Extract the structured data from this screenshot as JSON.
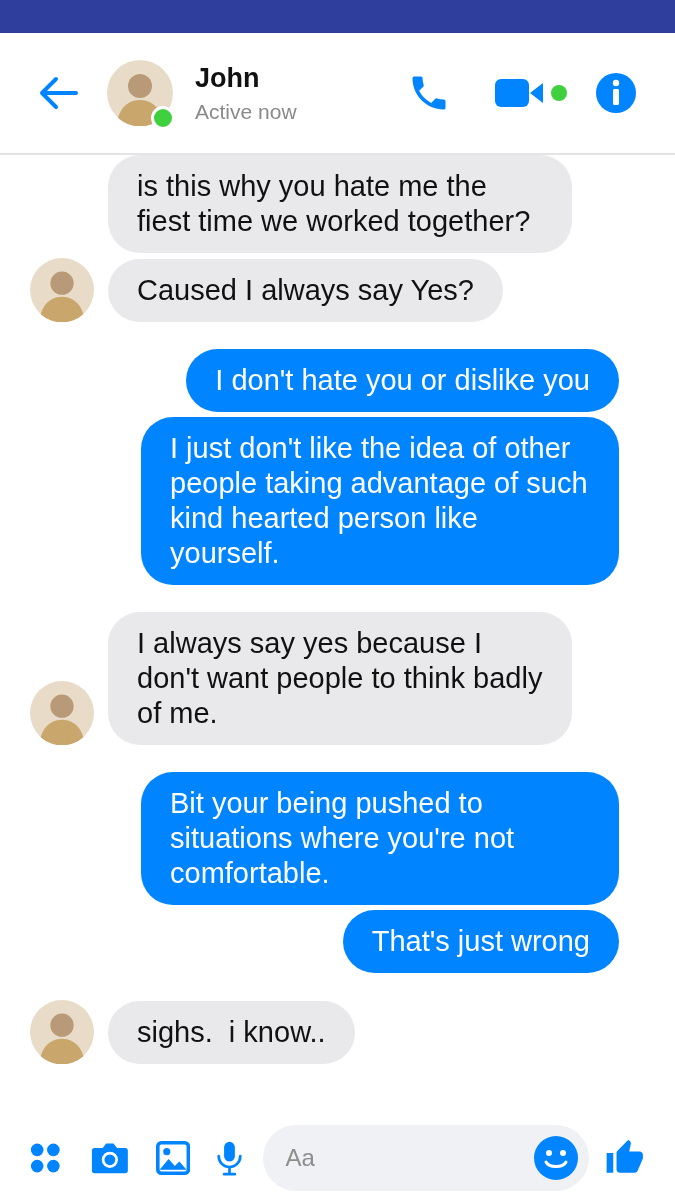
{
  "contact": {
    "name": "John",
    "status": "Active now",
    "online": true
  },
  "messages": [
    {
      "kind": "incoming",
      "text": "is this why you hate me the fiest time we worked together?"
    },
    {
      "kind": "incoming",
      "text": "Caused I always say Yes?"
    },
    {
      "kind": "outgoing",
      "text": "I don't hate you or dislike you"
    },
    {
      "kind": "outgoing",
      "text": "I just don't like the idea of other people taking advantage of such kind hearted person like yourself."
    },
    {
      "kind": "incoming",
      "text": "I always say yes because I don't want people to think badly of me."
    },
    {
      "kind": "outgoing",
      "text": "Bit your being pushed to situations where you're not comfortable."
    },
    {
      "kind": "outgoing",
      "text": "That's just wrong"
    },
    {
      "kind": "incoming",
      "text": "sighs.  i know.."
    }
  ],
  "composer": {
    "placeholder": "Aa"
  }
}
